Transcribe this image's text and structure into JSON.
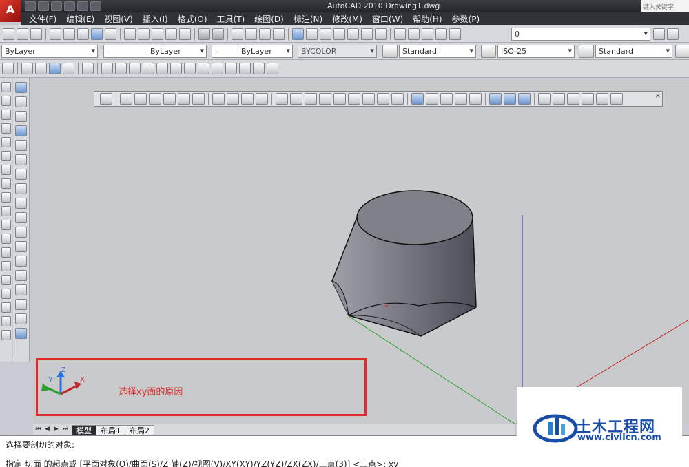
{
  "title_bar": {
    "app_logo": "A",
    "title": "AutoCAD 2010    Drawing1.dwg",
    "search_placeholder": "键入关键字"
  },
  "menu": [
    "文件(F)",
    "编辑(E)",
    "视图(V)",
    "插入(I)",
    "格式(O)",
    "工具(T)",
    "绘图(D)",
    "标注(N)",
    "修改(M)",
    "窗口(W)",
    "帮助(H)",
    "参数(P)"
  ],
  "toolbars": {
    "layer_value": "0",
    "color_combo": "ByLayer",
    "linetype_combo": "ByLayer",
    "lineweight_combo": "ByLayer",
    "plotstyle_combo": "BYCOLOR",
    "text_style": "Standard",
    "dim_style": "ISO-25",
    "table_style": "Standard"
  },
  "tabs": {
    "model": "模型",
    "layout1": "布局1",
    "layout2": "布局2"
  },
  "annotation": {
    "text": "选择xy面的原因",
    "color": "#e22c2c"
  },
  "ucs_icon": {
    "x_label": "X",
    "y_label": "Y",
    "z_label": "Z"
  },
  "command_line": {
    "line1": "选择要剖切的对象:",
    "line2": "指定 切面 的起点或 [平面对象(O)/曲面(S)/Z 轴(Z)/视图(V)/XY(XY)/YZ(YZ)/ZX(ZX)/三点(3)] <三点>: xy"
  },
  "watermark": {
    "title": "土木工程网",
    "url": "www.civilcn.com"
  },
  "colors": {
    "axis_x": "#c0262a",
    "axis_y": "#2aa02a",
    "axis_z": "#2323c8",
    "solid": "#6e6f78",
    "canvas": "#c9cacc"
  }
}
